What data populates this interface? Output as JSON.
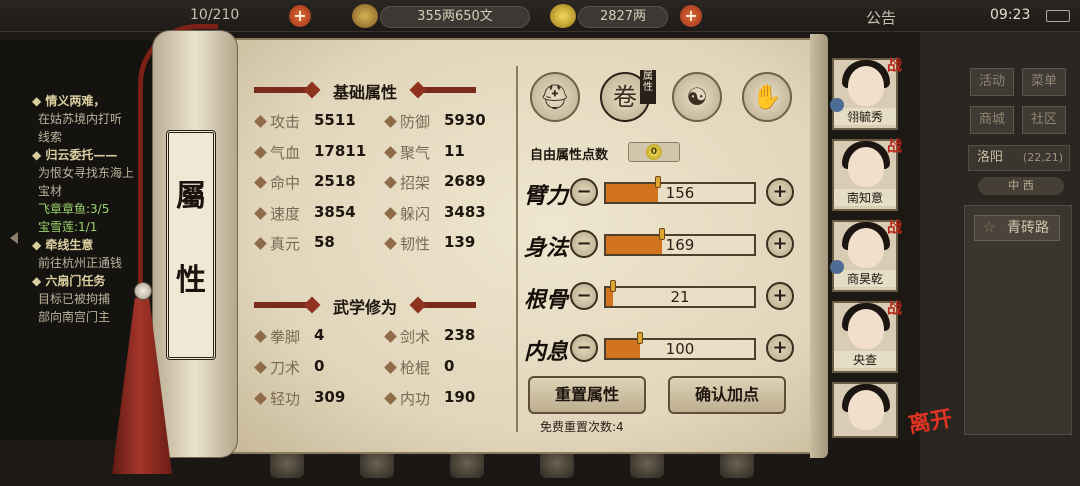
{
  "topbar": {
    "capacity": "10/210",
    "money": "355两650文",
    "gold": "2827两",
    "notice": "公告",
    "time": "09:23"
  },
  "quests": [
    {
      "text": "◆ 情义两难，",
      "type": "title"
    },
    {
      "text": "在姑苏境内打听",
      "type": "body"
    },
    {
      "text": "线索",
      "type": "body"
    },
    {
      "text": "◆ 归云委托——",
      "type": "title"
    },
    {
      "text": "为恨女寻找东海上",
      "type": "body"
    },
    {
      "text": "宝材",
      "type": "body"
    },
    {
      "text": "飞章章鱼:3/5",
      "type": "green"
    },
    {
      "text": "宝雪莲:1/1",
      "type": "green"
    },
    {
      "text": "◆ 牵线生意",
      "type": "title"
    },
    {
      "text": "前往杭州正通钱",
      "type": "body"
    },
    {
      "text": "◆ 六扇门任务",
      "type": "title"
    },
    {
      "text": "目标已被拘捕",
      "type": "body"
    },
    {
      "text": "部向南宫门主",
      "type": "body"
    }
  ],
  "right_panel": {
    "buttons": [
      "活动",
      "菜单",
      "商城",
      "社区"
    ],
    "city": "洛阳",
    "coord": "(22,21)",
    "compass": "中  西",
    "road": "青砖路"
  },
  "dialog": {
    "rod_label": [
      "屬",
      "性"
    ],
    "base_title": "基础属性",
    "martial_title": "武学修为",
    "base_stats": [
      {
        "label": "攻击",
        "value": "5511"
      },
      {
        "label": "防御",
        "value": "5930"
      },
      {
        "label": "气血",
        "value": "17811"
      },
      {
        "label": "聚气",
        "value": "11"
      },
      {
        "label": "命中",
        "value": "2518"
      },
      {
        "label": "招架",
        "value": "2689"
      },
      {
        "label": "速度",
        "value": "3854"
      },
      {
        "label": "躲闪",
        "value": "3483"
      },
      {
        "label": "真元",
        "value": "58"
      },
      {
        "label": "韧性",
        "value": "139"
      }
    ],
    "martial_stats": [
      {
        "label": "拳脚",
        "value": "4"
      },
      {
        "label": "剑术",
        "value": "238"
      },
      {
        "label": "刀术",
        "value": "0"
      },
      {
        "label": "枪棍",
        "value": "0"
      },
      {
        "label": "轻功",
        "value": "309"
      },
      {
        "label": "内功",
        "value": "190"
      }
    ],
    "tabs": [
      {
        "icon": "hat-icon",
        "glyph": "⛑"
      },
      {
        "icon": "scroll-attribute-icon",
        "glyph": "卷",
        "active_label": "属性"
      },
      {
        "icon": "yin-yang-icon",
        "glyph": "☯"
      },
      {
        "icon": "body-figure-icon",
        "glyph": "✋"
      }
    ],
    "free_points_label": "自由属性点数",
    "free_points_value": "0",
    "attributes": [
      {
        "name": "臂力",
        "value": "156",
        "fill": 0.35
      },
      {
        "name": "身法",
        "value": "169",
        "fill": 0.38
      },
      {
        "name": "根骨",
        "value": "21",
        "fill": 0.05
      },
      {
        "name": "内息",
        "value": "100",
        "fill": 0.23
      }
    ],
    "reset_button": "重置属性",
    "confirm_button": "确认加点",
    "free_reset_text": "免费重置次数:4"
  },
  "heroes": [
    {
      "name": "翎毓秀",
      "badge": "战"
    },
    {
      "name": "南知意",
      "badge": "战"
    },
    {
      "name": "商昊乾",
      "badge": "战"
    },
    {
      "name": "央查",
      "badge": "战"
    },
    {
      "name": "",
      "badge": ""
    }
  ],
  "leave_label": "离开",
  "colors": {
    "accent": "#7a2b1b",
    "bar_fill": "#d2741f",
    "paper": "#e8dec4",
    "badge_red": "#b8281a"
  }
}
